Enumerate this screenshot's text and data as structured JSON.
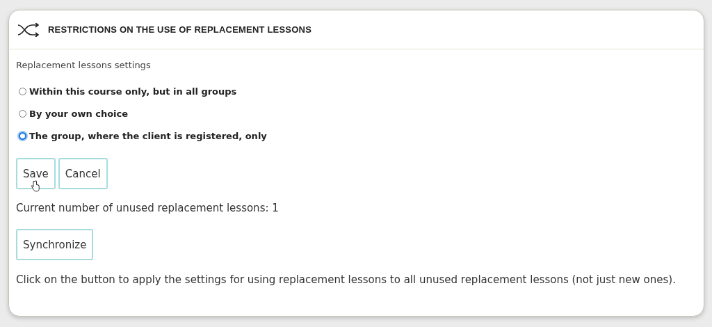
{
  "panel": {
    "title": "RESTRICTIONS ON THE USE OF REPLACEMENT LESSONS"
  },
  "settings": {
    "label": "Replacement lessons settings",
    "options": [
      {
        "label": "Within this course only, but in all groups",
        "selected": false
      },
      {
        "label": "By your own choice",
        "selected": false
      },
      {
        "label": "The group, where the client is registered, only",
        "selected": true
      }
    ]
  },
  "actions": [
    "Save",
    "Cancel"
  ],
  "unused_count": "Current number of unused replacement lessons: 1",
  "sync_button": "Synchronize",
  "note": "Click on the button to apply the settings for using replacement lessons to all unused replacement lessons (not just new ones)."
}
